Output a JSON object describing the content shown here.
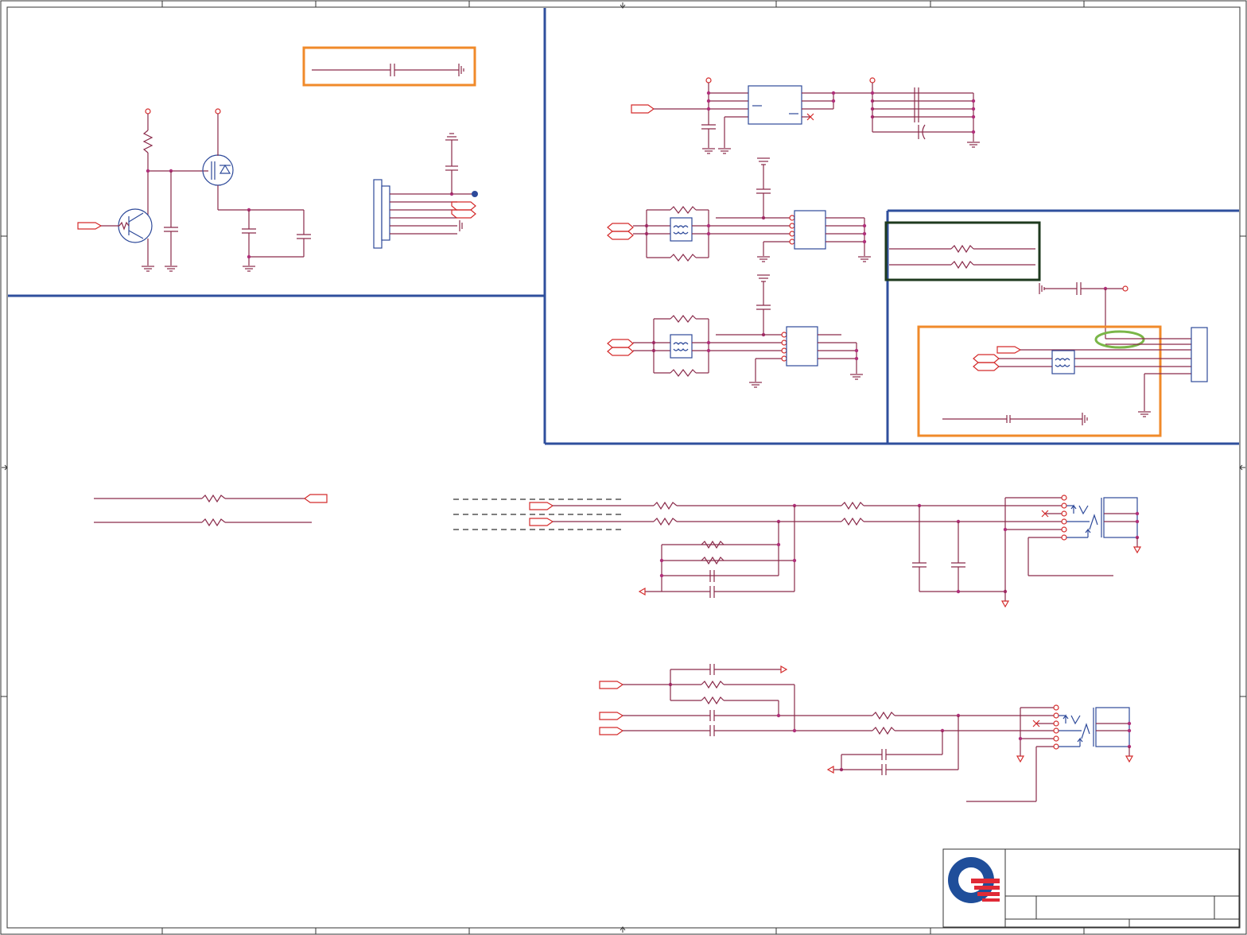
{
  "page": {
    "background": "#ffffff",
    "colors": {
      "wire": "#8a2a4a",
      "pin": "#d42b2b",
      "symbol": "#2e4a9a",
      "junction": "#b0307a",
      "section_border": "#2f4f9d",
      "highlight_orange": "#f08a2a",
      "highlight_dark_green": "#1e3a1e",
      "highlight_green": "#7ab648",
      "logo_blue": "#1f4e9a",
      "logo_red": "#e02a36"
    }
  },
  "title_block": {
    "logo": "company-logo-mark"
  }
}
